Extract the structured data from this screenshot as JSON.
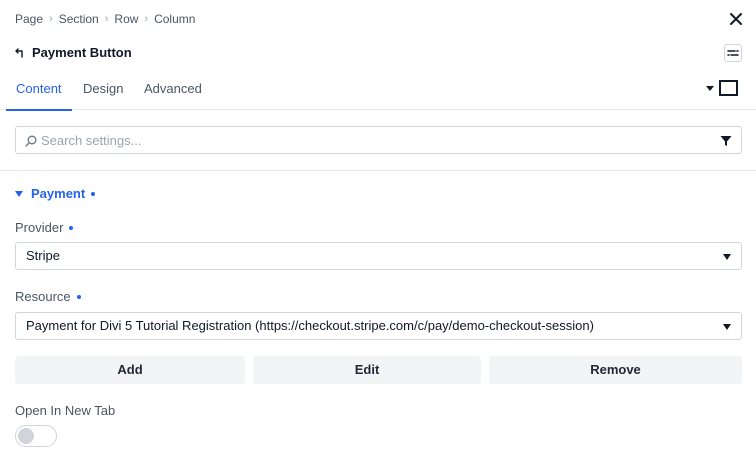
{
  "breadcrumb": [
    "Page",
    "Section",
    "Row",
    "Column"
  ],
  "header": {
    "title": "Payment Button"
  },
  "tabs": [
    {
      "label": "Content",
      "active": true
    },
    {
      "label": "Design",
      "active": false
    },
    {
      "label": "Advanced",
      "active": false
    }
  ],
  "search": {
    "placeholder": "Search settings...",
    "value": ""
  },
  "section": {
    "title": "Payment"
  },
  "fields": {
    "provider": {
      "label": "Provider",
      "value": "Stripe"
    },
    "resource": {
      "label": "Resource",
      "value": "Payment for Divi 5 Tutorial Registration (https://checkout.stripe.com/c/pay/demo-checkout-session)"
    },
    "open_new_tab": {
      "label": "Open In New Tab",
      "enabled": false
    }
  },
  "actions": {
    "add": "Add",
    "edit": "Edit",
    "remove": "Remove"
  },
  "colors": {
    "accent": "#2563eb",
    "text": "#1f2937",
    "muted": "#4b5563",
    "border": "#d1d5db",
    "button_bg": "#f3f4f6"
  },
  "icons": [
    "close-icon",
    "back-arrow-icon",
    "layout-toggle-icon",
    "search-icon",
    "filter-icon",
    "chevron-down-icon",
    "square-icon"
  ]
}
